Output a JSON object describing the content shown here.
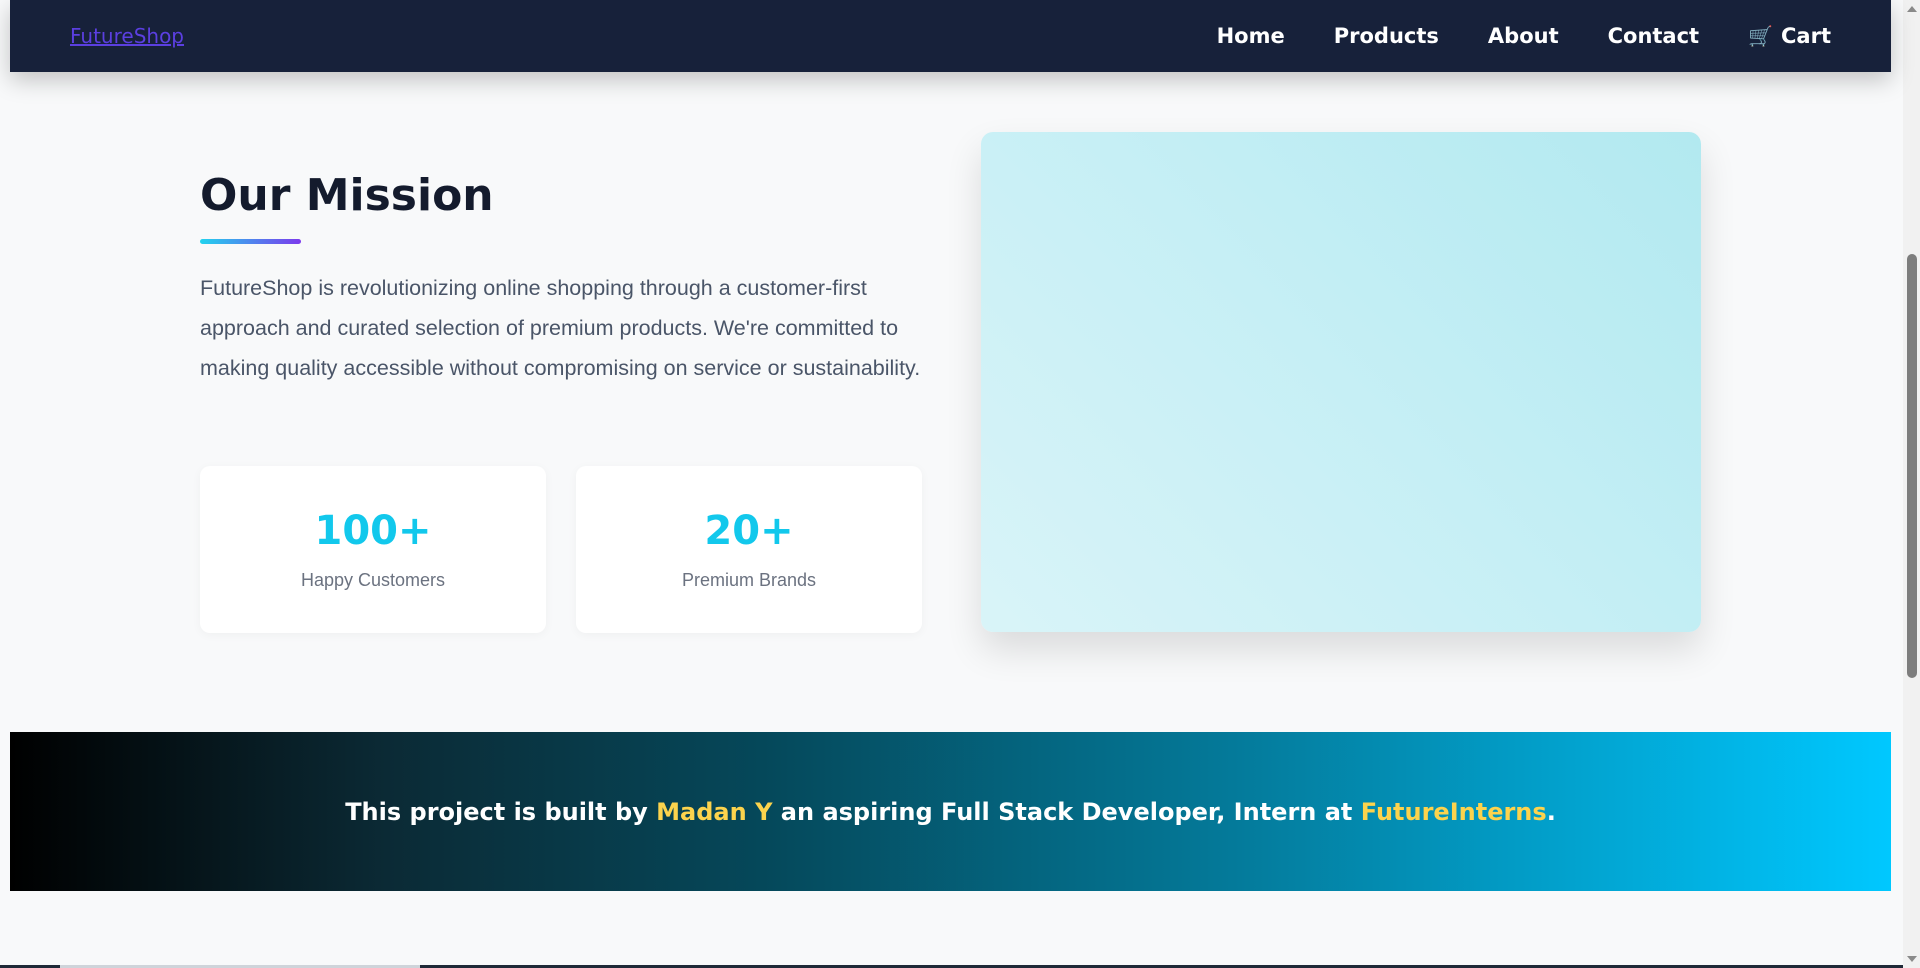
{
  "navbar": {
    "brand": "FutureShop",
    "links": [
      "Home",
      "Products",
      "About",
      "Contact"
    ],
    "cart_label": "Cart",
    "cart_icon": "🛒"
  },
  "mission": {
    "title": "Our Mission",
    "text": "FutureShop is revolutionizing online shopping through a customer-first approach and curated selection of premium products. We're committed to making quality accessible without compromising on service or sustainability."
  },
  "stats": [
    {
      "number": "100+",
      "label": "Happy Customers"
    },
    {
      "number": "20+",
      "label": "Premium Brands"
    }
  ],
  "banner": {
    "prefix": "This project is built by ",
    "name": "Madan Y",
    "middle": " an aspiring Full Stack Developer, Intern at ",
    "org": "FutureInterns",
    "suffix": "."
  },
  "colors": {
    "navbar_bg": "#17213a",
    "accent_cyan": "#12c8ec",
    "highlight_yellow": "#fcd34d"
  }
}
